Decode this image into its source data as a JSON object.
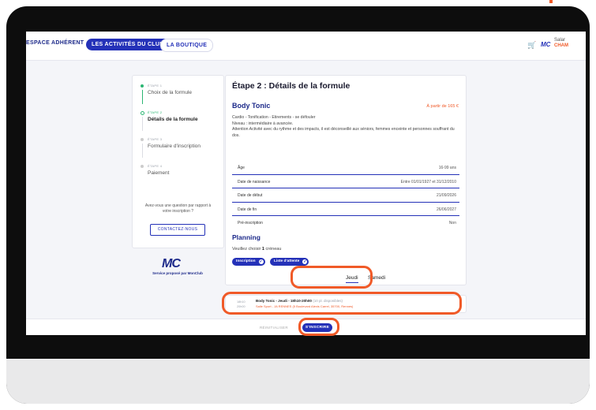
{
  "nav": {
    "items": [
      "ESPACE ADHÉRENT",
      "LES ACTIVITÉS DU CLUB",
      "LA BOUTIQUE"
    ],
    "active_index": 1,
    "user_line1": "Salar",
    "user_line2": "CHAM",
    "logo": "MC",
    "cart_icon": "cart-icon"
  },
  "stepper": {
    "steps": [
      {
        "number": "ÉTAPE 1",
        "title": "Choix de la formule",
        "state": "done"
      },
      {
        "number": "ÉTAPE 2",
        "title": "Détails de la formule",
        "state": "active"
      },
      {
        "number": "ÉTAPE 3",
        "title": "Formulaire d'inscription",
        "state": "todo"
      },
      {
        "number": "ÉTAPE 4",
        "title": "Paiement",
        "state": "todo"
      }
    ],
    "question": "Avez-vous une question par rapport à votre inscription ?",
    "contact_label": "CONTACTEZ-NOUS"
  },
  "brand": {
    "logo": "MC",
    "caption": "Service proposé par MonClub"
  },
  "details": {
    "title": "Étape 2 : Détails de la formule",
    "course_name": "Body Tonic",
    "price": "À partir de 165 €",
    "desc_line1": "Cardio - Tonification - Etirements - se défouler",
    "desc_line2": "Niveau : intermédiaire à avancée.",
    "desc_line3": "Attention Activité avec du rythme et des impacts, il est déconseillé aux séniors, femmes enceinte et personnes souffrant du dos.",
    "info": [
      {
        "label": "Âge",
        "value": "16-99 ans"
      },
      {
        "label": "Date de naissance",
        "value": "Entre 01/01/1927 et 31/12/2010"
      },
      {
        "label": "Date de début",
        "value": "21/09/2026"
      },
      {
        "label": "Date de fin",
        "value": "26/06/2027"
      },
      {
        "label": "Pré-inscription",
        "value": "Non"
      }
    ]
  },
  "planning": {
    "title": "Planning",
    "choose_prefix": "Veuillez choisir",
    "choose_count": "1",
    "choose_suffix": "créneau",
    "tags": [
      "Inscription",
      "Liste d'attente"
    ],
    "days": [
      "Jeudi",
      "Samedi"
    ],
    "active_day": 0
  },
  "slot": {
    "start": "18h10",
    "end": "20h00",
    "title": "Body Tonic - Jeudi - 18h10-20h00",
    "places": "(10 pl. disponibles)",
    "location": "Salle Sport - JA RENNES (5 Boulevard Alexis Carrel, 35700, Rennes)"
  },
  "footer": {
    "reset_label": "RÉINITIALISER",
    "signup_label": "S'INSCRIRE"
  },
  "colors": {
    "primary": "#2431b8",
    "accent_orange": "#f05a28",
    "success_green": "#2bb673"
  }
}
